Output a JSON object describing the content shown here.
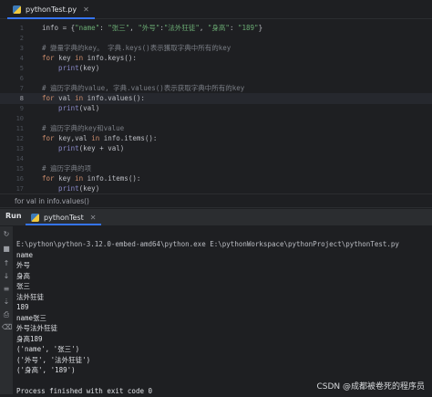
{
  "editor": {
    "tab_label": "pythonTest.py",
    "lines": [
      {
        "n": "1",
        "parts": [
          {
            "c": "plain",
            "t": "info = {"
          },
          {
            "c": "str",
            "t": "\"name\""
          },
          {
            "c": "plain",
            "t": ": "
          },
          {
            "c": "str",
            "t": "\"张三\""
          },
          {
            "c": "plain",
            "t": ", "
          },
          {
            "c": "str",
            "t": "\"外号\""
          },
          {
            "c": "plain",
            "t": ":"
          },
          {
            "c": "str",
            "t": "\"法外狂徒\""
          },
          {
            "c": "plain",
            "t": ", "
          },
          {
            "c": "str",
            "t": "\"身高\""
          },
          {
            "c": "plain",
            "t": ": "
          },
          {
            "c": "str",
            "t": "\"189\""
          },
          {
            "c": "plain",
            "t": "}"
          }
        ]
      },
      {
        "n": "2",
        "parts": []
      },
      {
        "n": "3",
        "parts": [
          {
            "c": "cm",
            "t": "# 變量字典的key。 字典.keys()表示獲取字典中所有的key"
          }
        ]
      },
      {
        "n": "4",
        "parts": [
          {
            "c": "kw",
            "t": "for "
          },
          {
            "c": "plain",
            "t": "key "
          },
          {
            "c": "kw",
            "t": "in "
          },
          {
            "c": "plain",
            "t": "info.keys():"
          }
        ]
      },
      {
        "n": "5",
        "parts": [
          {
            "c": "fn",
            "t": "    print"
          },
          {
            "c": "plain",
            "t": "(key)"
          }
        ]
      },
      {
        "n": "6",
        "parts": []
      },
      {
        "n": "7",
        "parts": [
          {
            "c": "cm",
            "t": "# 遍历字典的value, 字典.values()表示获取字典中所有的key"
          }
        ]
      },
      {
        "n": "8",
        "parts": [
          {
            "c": "kw",
            "t": "for "
          },
          {
            "c": "plain",
            "t": "val "
          },
          {
            "c": "kw",
            "t": "in "
          },
          {
            "c": "plain",
            "t": "info.values():"
          }
        ],
        "current": true
      },
      {
        "n": "9",
        "parts": [
          {
            "c": "fn",
            "t": "    print"
          },
          {
            "c": "plain",
            "t": "(val)"
          }
        ]
      },
      {
        "n": "10",
        "parts": []
      },
      {
        "n": "11",
        "parts": [
          {
            "c": "cm",
            "t": "# 遍历字典的key和value"
          }
        ]
      },
      {
        "n": "12",
        "parts": [
          {
            "c": "kw",
            "t": "for "
          },
          {
            "c": "plain",
            "t": "key,val "
          },
          {
            "c": "kw",
            "t": "in "
          },
          {
            "c": "plain",
            "t": "info.items():"
          }
        ]
      },
      {
        "n": "13",
        "parts": [
          {
            "c": "fn",
            "t": "    print"
          },
          {
            "c": "plain",
            "t": "(key + val)"
          }
        ]
      },
      {
        "n": "14",
        "parts": []
      },
      {
        "n": "15",
        "parts": [
          {
            "c": "cm",
            "t": "# 遍历字典的项"
          }
        ]
      },
      {
        "n": "16",
        "parts": [
          {
            "c": "kw",
            "t": "for "
          },
          {
            "c": "plain",
            "t": "key "
          },
          {
            "c": "kw",
            "t": "in "
          },
          {
            "c": "plain",
            "t": "info.items():"
          }
        ]
      },
      {
        "n": "17",
        "parts": [
          {
            "c": "fn",
            "t": "    print"
          },
          {
            "c": "plain",
            "t": "(key)"
          }
        ]
      }
    ]
  },
  "breadcrumb": "for val in info.values()",
  "run": {
    "title": "Run",
    "tab_label": "pythonTest",
    "output": [
      "E:\\python\\python-3.12.0-embed-amd64\\python.exe E:\\pythonWorkspace\\pythonProject\\pythonTest.py",
      "name",
      "外号",
      "身高",
      "张三",
      "法外狂徒",
      "189",
      "name张三",
      "外号法外狂徒",
      "身高189",
      "('name', '张三')",
      "('外号', '法外狂徒')",
      "('身高', '189')",
      "",
      "Process finished with exit code 0"
    ]
  },
  "watermark": "CSDN @成都被卷死的程序员"
}
